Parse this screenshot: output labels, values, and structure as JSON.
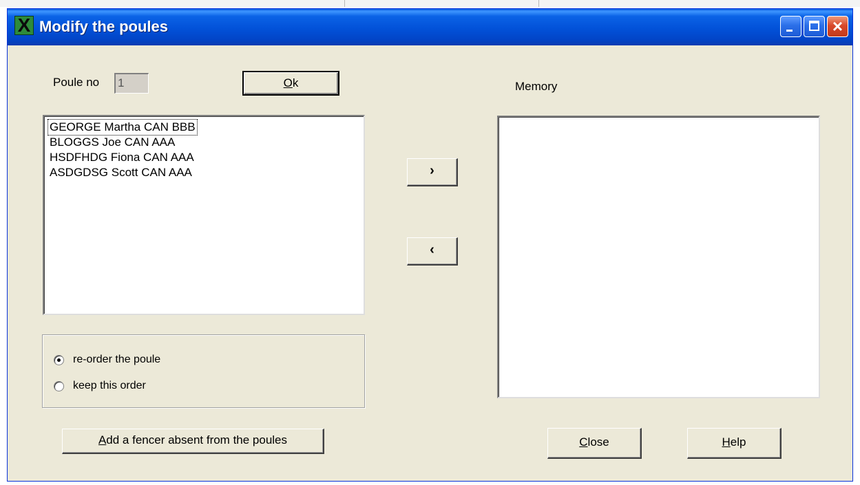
{
  "window": {
    "title": "Modify the poules",
    "title_bar_color": "#0a5be0",
    "icons": {
      "app": "fencing-app-icon",
      "minimize": "minimize-icon",
      "maximize": "maximize-icon",
      "close": "close-icon"
    }
  },
  "poule": {
    "label": "Poule no",
    "number": "1"
  },
  "buttons": {
    "ok": {
      "mnemonic": "O",
      "rest": "k"
    },
    "move_right": "›",
    "move_left": "‹",
    "add_fencer": {
      "mnemonic": "A",
      "rest": "dd a fencer absent from the poules"
    },
    "close": {
      "mnemonic": "C",
      "rest": "lose"
    },
    "help": {
      "mnemonic": "H",
      "rest": "elp"
    }
  },
  "memory": {
    "label": "Memory",
    "items": []
  },
  "fencer_list": [
    {
      "text": "GEORGE Martha CAN BBB",
      "focused": true
    },
    {
      "text": "BLOGGS Joe CAN AAA",
      "focused": false
    },
    {
      "text": "HSDFHDG Fiona CAN AAA",
      "focused": false
    },
    {
      "text": "ASDGDSG Scott CAN AAA",
      "focused": false
    }
  ],
  "order_options": [
    {
      "label": "re-order the poule",
      "selected": true
    },
    {
      "label": "keep this order",
      "selected": false
    }
  ]
}
